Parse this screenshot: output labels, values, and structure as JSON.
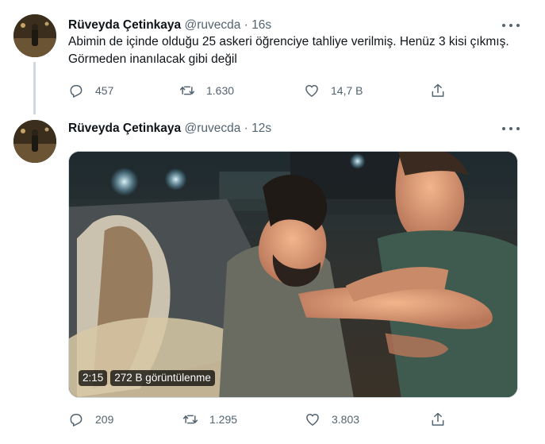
{
  "tweets": [
    {
      "name": "Rüveyda Çetinkaya",
      "handle": "@ruvecda",
      "separator": "·",
      "time": "16s",
      "text": "Abimin de içinde olduğu 25 askeri öğrenciye tahliye verilmiş. Henüz 3 kisi çıkmış. Görmeden inanılacak gibi değil",
      "replies": "457",
      "retweets": "1.630",
      "likes": "14,7 B"
    },
    {
      "name": "Rüveyda Çetinkaya",
      "handle": "@ruvecda",
      "separator": "·",
      "time": "12s",
      "media": {
        "duration": "2:15",
        "views": "272 B görüntülenme"
      },
      "replies": "209",
      "retweets": "1.295",
      "likes": "3.803"
    }
  ],
  "icons": {
    "reply": "reply-icon",
    "retweet": "retweet-icon",
    "like": "heart-icon",
    "share": "share-icon",
    "more": "more-icon"
  },
  "colors": {
    "text": "#0f1419",
    "secondary": "#536471",
    "thread_line": "#cfd9de"
  }
}
